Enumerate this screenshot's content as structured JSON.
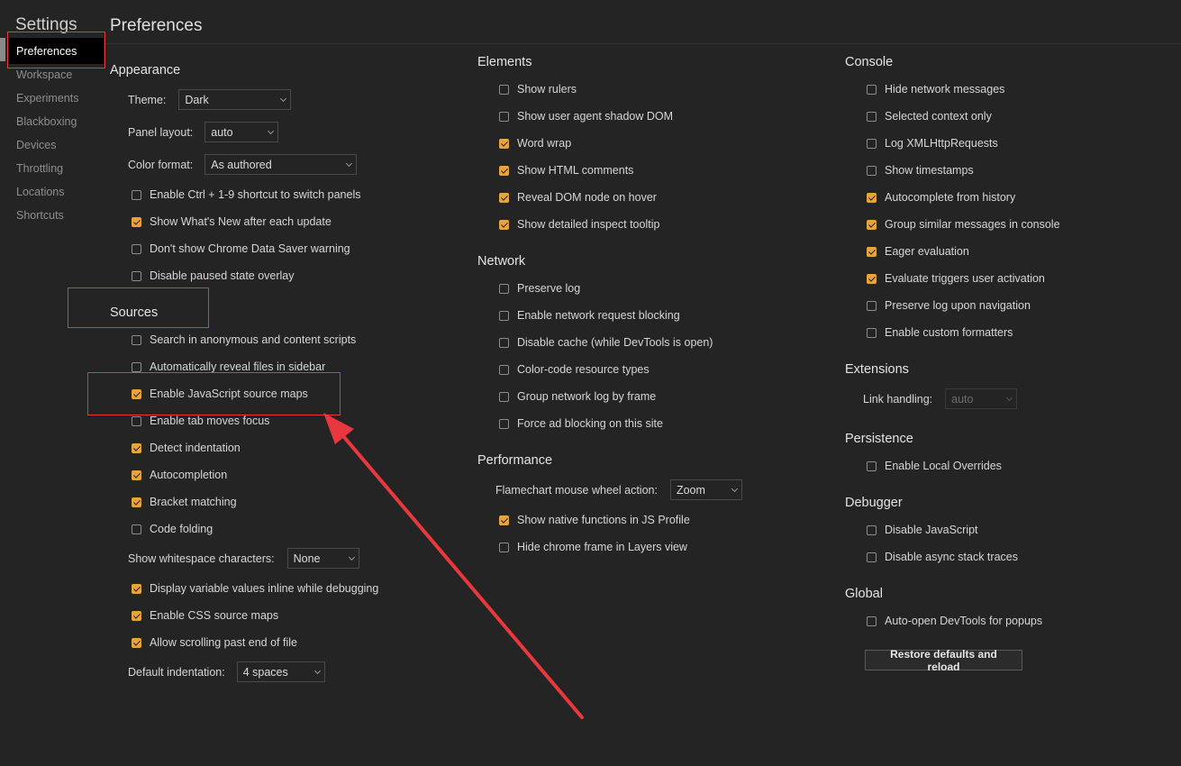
{
  "window": {
    "settings_title": "Settings",
    "page_title": "Preferences"
  },
  "sidebar": {
    "items": [
      {
        "label": "Preferences",
        "active": true
      },
      {
        "label": "Workspace"
      },
      {
        "label": "Experiments"
      },
      {
        "label": "Blackboxing"
      },
      {
        "label": "Devices"
      },
      {
        "label": "Throttling"
      },
      {
        "label": "Locations"
      },
      {
        "label": "Shortcuts"
      }
    ]
  },
  "appearance": {
    "title": "Appearance",
    "theme": {
      "label": "Theme:",
      "value": "Dark"
    },
    "panel_layout": {
      "label": "Panel layout:",
      "value": "auto"
    },
    "color_format": {
      "label": "Color format:",
      "value": "As authored"
    },
    "checks": [
      {
        "label": "Enable Ctrl + 1-9 shortcut to switch panels",
        "checked": false
      },
      {
        "label": "Show What's New after each update",
        "checked": true
      },
      {
        "label": "Don't show Chrome Data Saver warning",
        "checked": false
      },
      {
        "label": "Disable paused state overlay",
        "checked": false
      }
    ]
  },
  "sources": {
    "title": "Sources",
    "checks": [
      {
        "label": "Search in anonymous and content scripts",
        "checked": false
      },
      {
        "label": "Automatically reveal files in sidebar",
        "checked": false
      },
      {
        "label": "Enable JavaScript source maps",
        "checked": true
      },
      {
        "label": "Enable tab moves focus",
        "checked": false
      },
      {
        "label": "Detect indentation",
        "checked": true
      },
      {
        "label": "Autocompletion",
        "checked": true
      },
      {
        "label": "Bracket matching",
        "checked": true
      },
      {
        "label": "Code folding",
        "checked": false
      }
    ],
    "whitespace": {
      "label": "Show whitespace characters:",
      "value": "None"
    },
    "checks2": [
      {
        "label": "Display variable values inline while debugging",
        "checked": true
      },
      {
        "label": "Enable CSS source maps",
        "checked": true
      },
      {
        "label": "Allow scrolling past end of file",
        "checked": true
      }
    ],
    "indentation": {
      "label": "Default indentation:",
      "value": "4 spaces"
    }
  },
  "elements": {
    "title": "Elements",
    "checks": [
      {
        "label": "Show rulers",
        "checked": false
      },
      {
        "label": "Show user agent shadow DOM",
        "checked": false
      },
      {
        "label": "Word wrap",
        "checked": true
      },
      {
        "label": "Show HTML comments",
        "checked": true
      },
      {
        "label": "Reveal DOM node on hover",
        "checked": true
      },
      {
        "label": "Show detailed inspect tooltip",
        "checked": true
      }
    ]
  },
  "network": {
    "title": "Network",
    "checks": [
      {
        "label": "Preserve log",
        "checked": false
      },
      {
        "label": "Enable network request blocking",
        "checked": false
      },
      {
        "label": "Disable cache (while DevTools is open)",
        "checked": false
      },
      {
        "label": "Color-code resource types",
        "checked": false
      },
      {
        "label": "Group network log by frame",
        "checked": false
      },
      {
        "label": "Force ad blocking on this site",
        "checked": false
      }
    ]
  },
  "performance": {
    "title": "Performance",
    "flamechart": {
      "label": "Flamechart mouse wheel action:",
      "value": "Zoom"
    },
    "checks": [
      {
        "label": "Show native functions in JS Profile",
        "checked": true
      },
      {
        "label": "Hide chrome frame in Layers view",
        "checked": false
      }
    ]
  },
  "console": {
    "title": "Console",
    "checks": [
      {
        "label": "Hide network messages",
        "checked": false
      },
      {
        "label": "Selected context only",
        "checked": false
      },
      {
        "label": "Log XMLHttpRequests",
        "checked": false
      },
      {
        "label": "Show timestamps",
        "checked": false
      },
      {
        "label": "Autocomplete from history",
        "checked": true
      },
      {
        "label": "Group similar messages in console",
        "checked": true
      },
      {
        "label": "Eager evaluation",
        "checked": true
      },
      {
        "label": "Evaluate triggers user activation",
        "checked": true
      },
      {
        "label": "Preserve log upon navigation",
        "checked": false
      },
      {
        "label": "Enable custom formatters",
        "checked": false
      }
    ]
  },
  "extensions": {
    "title": "Extensions",
    "link_handling": {
      "label": "Link handling:",
      "value": "auto"
    }
  },
  "persistence": {
    "title": "Persistence",
    "checks": [
      {
        "label": "Enable Local Overrides",
        "checked": false
      }
    ]
  },
  "debugger": {
    "title": "Debugger",
    "checks": [
      {
        "label": "Disable JavaScript",
        "checked": false
      },
      {
        "label": "Disable async stack traces",
        "checked": false
      }
    ]
  },
  "global": {
    "title": "Global",
    "checks": [
      {
        "label": "Auto-open DevTools for popups",
        "checked": false
      }
    ],
    "restore_label": "Restore defaults and reload"
  },
  "annotation": {
    "color": "#e8383d"
  },
  "colors": {
    "background": "#242424",
    "checkbox_checked": "#e8a33a"
  }
}
